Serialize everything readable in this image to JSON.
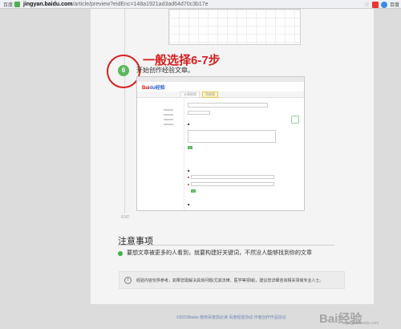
{
  "browser": {
    "brand": "百度",
    "url_domain": "jingyan.baidu.com",
    "url_path": "/article/preview?eidEnc=148a1921ad3ad64d70c3b17e",
    "right_text": "百度"
  },
  "step": {
    "number": "6",
    "callout": "一般选择6-7步",
    "text": "开始创作经验文章。"
  },
  "embedded": {
    "logo_bai": "Bai",
    "logo_rest": "du经验",
    "tabs": [
      "分享经验",
      "写经验"
    ]
  },
  "end_label": "END",
  "notice": {
    "title": "注意事项",
    "text": "要想文章被更多的人看到，就要构建好关键词，不然没人能够找到你的文章"
  },
  "info": {
    "icon": "info-icon",
    "text": "经验内容仅供参考，如果您需解决具体问题(尤其法律、医学等领域)，建议您详细咨询相关领域专业人士。"
  },
  "footer": {
    "text": "©2015Baidu  使用百度前必读  百度经验协议  作者创作作品协议"
  },
  "watermark": {
    "main": "Bai经验",
    "sub": "jingyan.baidu.com"
  },
  "colors": {
    "accent_red": "#d72020",
    "step_green": "#5cb85c"
  }
}
